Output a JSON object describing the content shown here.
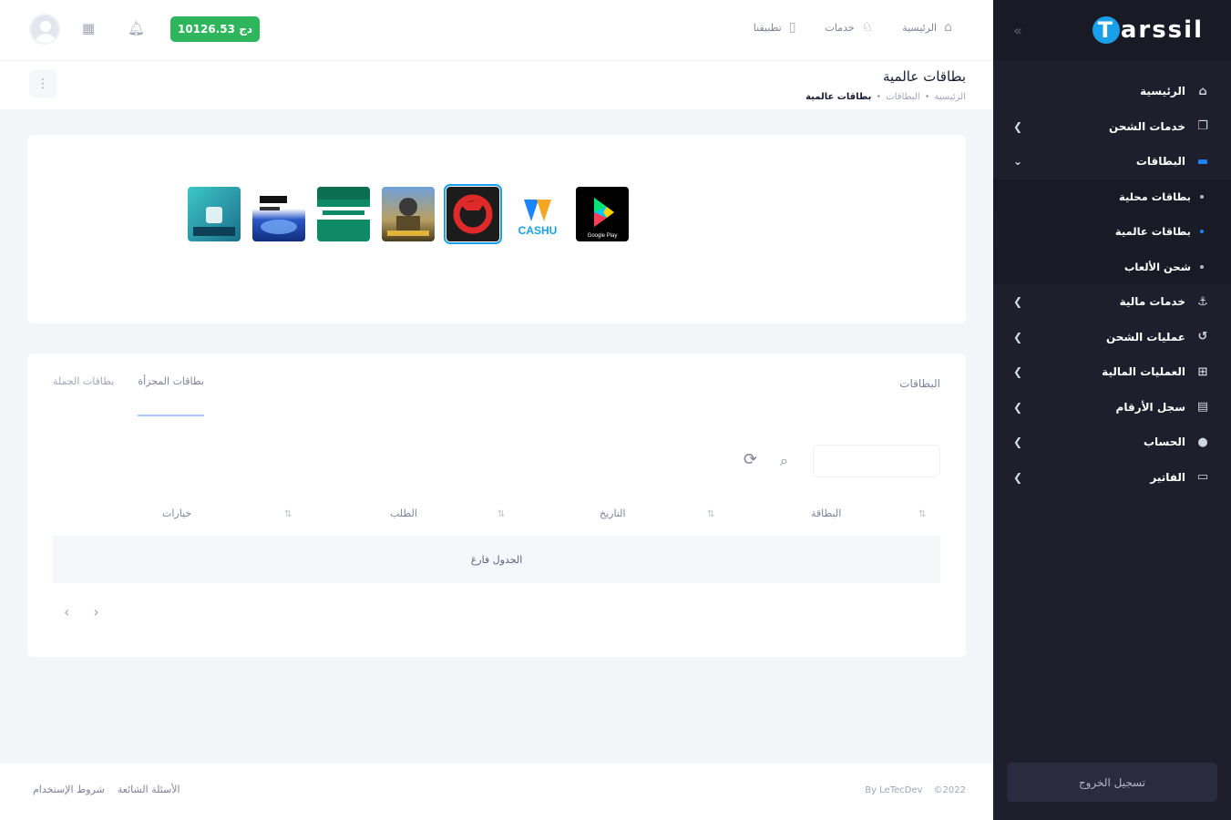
{
  "sidebar": {
    "logo": "arssil",
    "logo_initial": "T",
    "items": [
      {
        "label": "الرئيسية",
        "icon": "home-icon"
      },
      {
        "label": "خدمات الشحن",
        "icon": "copy-icon"
      },
      {
        "label": "البطاقات",
        "icon": "cards-icon"
      },
      {
        "label": "بطاقات محلية",
        "icon": "dot"
      },
      {
        "label": "بطاقات عالمية",
        "icon": "dot"
      },
      {
        "label": "شحن الألعاب",
        "icon": "dot"
      },
      {
        "label": "خدمات مالية",
        "icon": "anchor-icon"
      },
      {
        "label": "عمليات الشحن",
        "icon": "history-icon"
      },
      {
        "label": "العمليات المالية",
        "icon": "grid-icon"
      },
      {
        "label": "سجل الأرقام",
        "icon": "book-icon"
      },
      {
        "label": "الحساب",
        "icon": "user-icon"
      },
      {
        "label": "الفاتير",
        "icon": "card-icon"
      }
    ],
    "logout": "تسجيل الخروج"
  },
  "header": {
    "balance": "10126.53 دج",
    "nav": [
      {
        "label": "الرئيسية",
        "icon": "home-icon"
      },
      {
        "label": "خدمات",
        "icon": "headset-icon"
      },
      {
        "label": "تطبيقنا",
        "icon": "phone-icon"
      }
    ]
  },
  "toolbar": {
    "title": "بطاقات عالمية",
    "breadcrumb": [
      "الرئيسية",
      "البطاقات",
      "بطاقات عالمية"
    ]
  },
  "brands": [
    {
      "name": "itunes",
      "color": "#2aa7b8"
    },
    {
      "name": "mobilis-card",
      "color": "#1a3d8f"
    },
    {
      "name": "flexy-green",
      "color": "#0e8a66"
    },
    {
      "name": "pubg",
      "color": "#7c6e3a"
    },
    {
      "name": "free-fire",
      "color": "#1c1c1c"
    },
    {
      "name": "cashu",
      "label": "CASHU",
      "color": "#ffffff"
    },
    {
      "name": "google-play",
      "label": "Google Play",
      "color": "#000000"
    }
  ],
  "table_card": {
    "title": "البطاقات",
    "tabs": [
      "بطاقات المجزأة",
      "بطاقات الجملة"
    ],
    "columns": [
      "البطاقة",
      "التاريخ",
      "الطلب",
      "خيارات"
    ],
    "empty": "الجدول فارغ"
  },
  "footer": {
    "links": [
      "شروط الإستخدام",
      "الأسئلة الشائعة"
    ],
    "copyright": "©2022",
    "credit": "By LeTecDev"
  }
}
